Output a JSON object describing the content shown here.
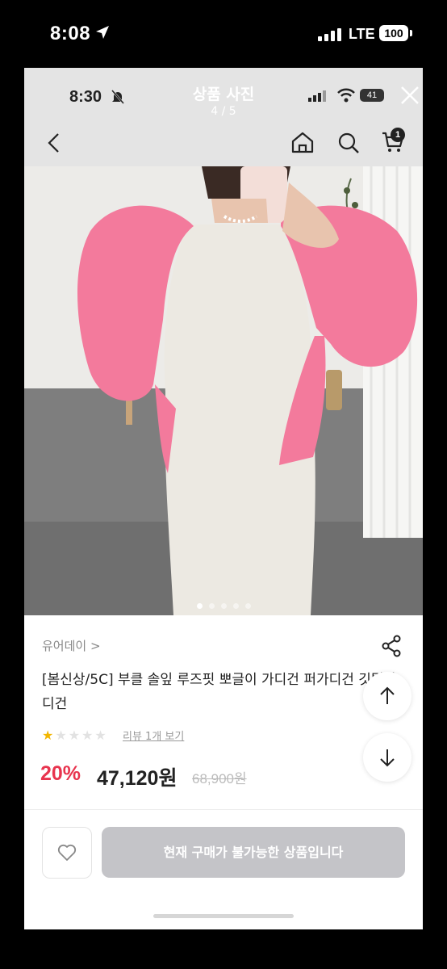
{
  "outer_status": {
    "time": "8:08",
    "network": "LTE",
    "battery": "100"
  },
  "inner_status": {
    "time": "8:30",
    "battery": "41"
  },
  "viewer": {
    "title": "상품 사진",
    "counter": "4 / 5"
  },
  "header": {
    "cart_count": "1"
  },
  "photo": {
    "total_pages": 5,
    "active_page": 1
  },
  "product": {
    "brand": "유어데이 >",
    "title": "[봄신상/5C] 부클 솔잎 루즈핏 뽀글이 가디건 퍼가디건 깃털가디건",
    "rating": 1,
    "review_link": "리뷰 1개 보기",
    "discount": "20%",
    "price": "47,120원",
    "original_price": "68,900원"
  },
  "purchase": {
    "button_label": "현재 구매가 불가능한 상품입니다"
  },
  "colors": {
    "discount": "#e8344e",
    "star": "#f2b600",
    "disabled_button": "#c4c4c8",
    "cardigan": "#f37a9c"
  }
}
